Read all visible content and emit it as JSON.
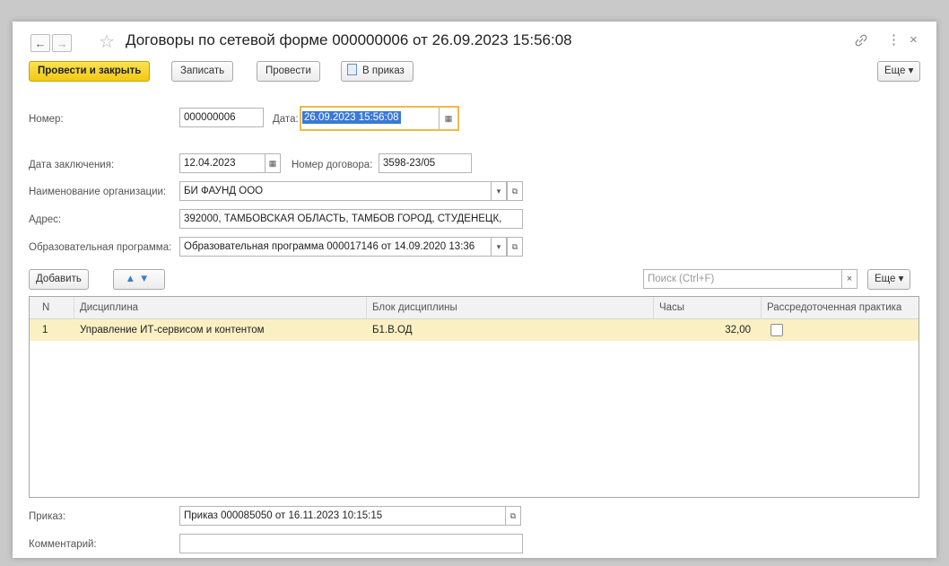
{
  "window": {
    "title": "Договоры по сетевой форме 000000006 от 26.09.2023 15:56:08",
    "nav_back": "←",
    "nav_forward": "→",
    "star": "☆",
    "link_icon": "🔗",
    "menu_icon": "⋮",
    "close_icon": "×"
  },
  "toolbar": {
    "post_close": "Провести и закрыть",
    "save": "Записать",
    "post": "Провести",
    "to_order": "В приказ",
    "more": "Еще ▾"
  },
  "form": {
    "number_label": "Номер:",
    "number_value": "000000006",
    "date_label": "Дата:",
    "date_value": "26.09.2023 15:56:08",
    "conclusion_label": "Дата заключения:",
    "conclusion_value": "12.04.2023",
    "contract_no_label": "Номер договора:",
    "contract_no_value": "3598-23/05",
    "org_label": "Наименование организации:",
    "org_value": "БИ ФАУНД ООО",
    "address_label": "Адрес:",
    "address_value": "392000, ТАМБОВСКАЯ ОБЛАСТЬ, ТАМБОВ ГОРОД, СТУДЕНЕЦК,",
    "program_label": "Образовательная программа:",
    "program_value": "Образовательная программа 000017146 от 14.09.2020 13:36",
    "order_label": "Приказ:",
    "order_value": "Приказ 000085050 от 16.11.2023 10:15:15",
    "comment_label": "Комментарий:",
    "comment_value": ""
  },
  "table_toolbar": {
    "add": "Добавить",
    "search_placeholder": "Поиск (Ctrl+F)",
    "clear": "×",
    "more": "Еще ▾"
  },
  "table": {
    "columns": [
      "N",
      "Дисциплина",
      "Блок дисциплины",
      "Часы",
      "Рассредоточенная практика"
    ],
    "rows": [
      {
        "n": "1",
        "discipline": "Управление ИТ-сервисом и контентом",
        "block": "Б1.В.ОД",
        "hours": "32,00",
        "distributed": false
      }
    ]
  },
  "colors": {
    "accent": "#f2c913",
    "selected_row": "#fbf0c4",
    "focus_border": "#f0b84a"
  }
}
